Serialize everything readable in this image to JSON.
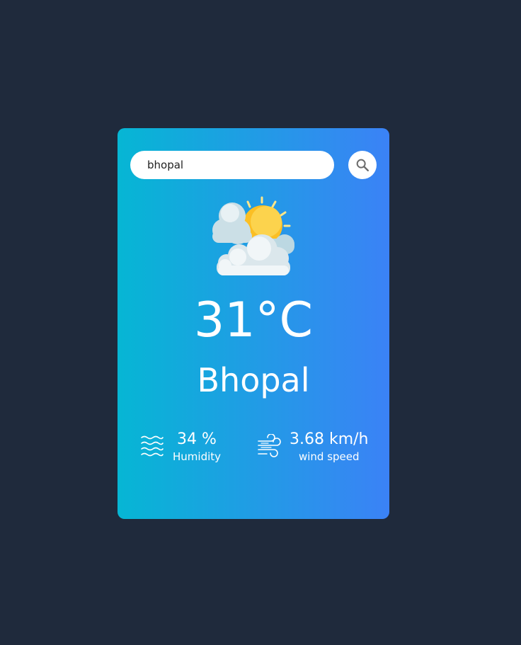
{
  "search": {
    "value": "bhopal",
    "button_icon": "search-icon"
  },
  "weather": {
    "icon": "partly-cloudy-sun-icon",
    "temperature": "31°C",
    "city": "Bhopal"
  },
  "details": {
    "humidity": {
      "value": "34 %",
      "label": "Humidity",
      "icon": "humidity-icon"
    },
    "wind": {
      "value": "3.68 km/h",
      "label": "wind speed",
      "icon": "wind-icon"
    }
  },
  "colors": {
    "background": "#1f2a3c",
    "gradient_start": "#06b6d4",
    "gradient_end": "#3b82f6",
    "text": "#ffffff"
  }
}
